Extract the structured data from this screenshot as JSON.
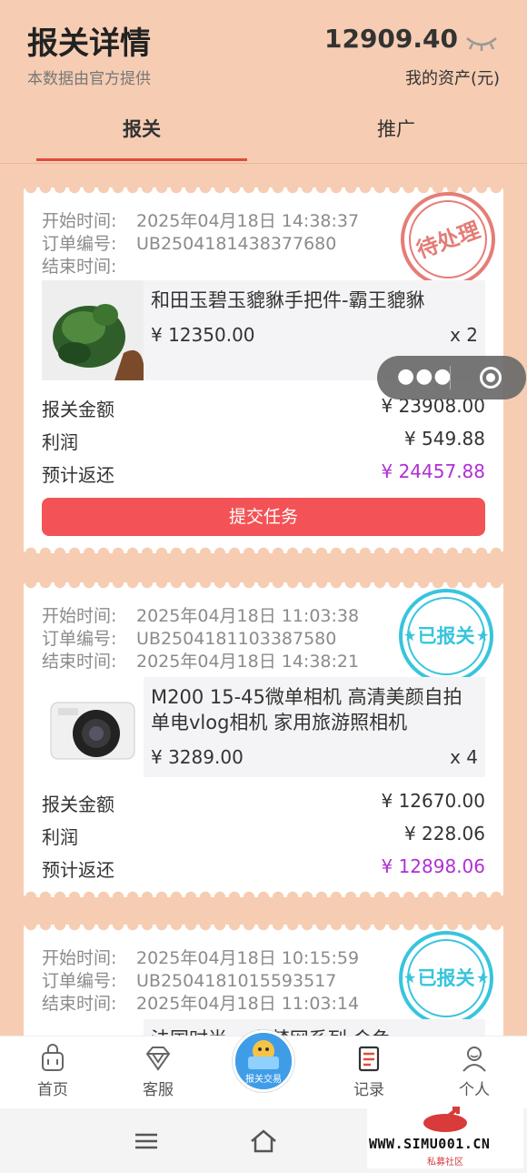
{
  "header": {
    "title": "报关详情",
    "subtitle": "本数据由官方提供",
    "assets_value": "12909.40",
    "assets_label": "我的资产(元)"
  },
  "tabs": [
    {
      "label": "报关",
      "active": true
    },
    {
      "label": "推广",
      "active": false
    }
  ],
  "orders": [
    {
      "start_label": "开始时间:",
      "start_time": "2025年04月18日 14:38:37",
      "order_label": "订单编号:",
      "order_no": "UB2504181438377680",
      "end_label": "结束时间:",
      "end_time": "",
      "stamp": "待处理",
      "product_name": "和田玉碧玉貔貅手把件-霸王貔貅",
      "price": "¥ 12350.00",
      "qty": "x 2",
      "amount_label": "报关金额",
      "amount": "¥ 23908.00",
      "profit_label": "利润",
      "profit": "¥ 549.88",
      "return_label": "预计返还",
      "return": "¥ 24457.88",
      "button": "提交任务"
    },
    {
      "start_label": "开始时间:",
      "start_time": "2025年04月18日 11:03:38",
      "order_label": "订单编号:",
      "order_no": "UB2504181103387580",
      "end_label": "结束时间:",
      "end_time": "2025年04月18日 14:38:21",
      "stamp": "已报关",
      "product_name": "M200 15-45微单相机 高清美颜自拍单电vlog相机 家用旅游照相机",
      "price": "¥ 3289.00",
      "qty": "x 4",
      "amount_label": "报关金额",
      "amount": "¥ 12670.00",
      "profit_label": "利润",
      "profit": "¥ 228.06",
      "return_label": "预计返还",
      "return": "¥ 12898.06"
    },
    {
      "start_label": "开始时间:",
      "start_time": "2025年04月18日 10:15:59",
      "order_label": "订单编号:",
      "order_no": "UB2504181015593517",
      "end_label": "结束时间:",
      "end_time": "2025年04月18日 11:03:14",
      "stamp": "已报关",
      "product_name": "法国时尚... 色梦网系列 会色"
    }
  ],
  "tabbar": [
    {
      "label": "首页",
      "icon": "home-bag-icon"
    },
    {
      "label": "客服",
      "icon": "diamond-icon"
    },
    {
      "label": "报关交易",
      "icon": "customs-trade-icon"
    },
    {
      "label": "记录",
      "icon": "record-icon"
    },
    {
      "label": "个人",
      "icon": "person-icon"
    }
  ],
  "watermark": {
    "text": "WWW.SIMU001.CN",
    "sub": "私募社区"
  },
  "colors": {
    "background": "#f6cdb3",
    "accent_red": "#f35356",
    "return_purple": "#b02fd5",
    "stamp_pending": "#e0665f",
    "stamp_done": "#37c5dd"
  }
}
